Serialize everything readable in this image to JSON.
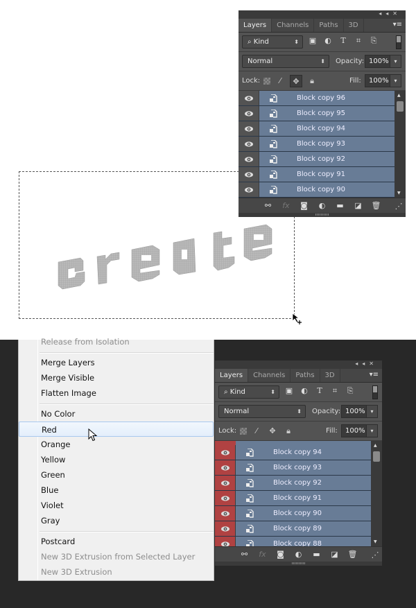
{
  "canvas": {
    "artwork_text": "create",
    "artwork_color": "#b8b8b8"
  },
  "panel_top": {
    "tabs": [
      "Layers",
      "Channels",
      "Paths",
      "3D"
    ],
    "active_tab": "Layers",
    "filter": {
      "label": "Kind"
    },
    "blend_mode": "Normal",
    "opacity_label": "Opacity:",
    "opacity_value": "100%",
    "lock_label": "Lock:",
    "fill_label": "Fill:",
    "fill_value": "100%",
    "layers": [
      {
        "name": "Block copy 96",
        "visible": true
      },
      {
        "name": "Block copy 95",
        "visible": true
      },
      {
        "name": "Block copy 94",
        "visible": true
      },
      {
        "name": "Block copy 93",
        "visible": true
      },
      {
        "name": "Block copy 92",
        "visible": true
      },
      {
        "name": "Block copy 91",
        "visible": true
      },
      {
        "name": "Block copy 90",
        "visible": true
      }
    ],
    "layer_color": "none"
  },
  "panel_bottom": {
    "tabs": [
      "Layers",
      "Channels",
      "Paths",
      "3D"
    ],
    "active_tab": "Layers",
    "filter": {
      "label": "Kind"
    },
    "blend_mode": "Normal",
    "opacity_label": "Opacity:",
    "opacity_value": "100%",
    "lock_label": "Lock:",
    "fill_label": "Fill:",
    "fill_value": "100%",
    "layers": [
      {
        "name": "Block copy 94",
        "visible": true
      },
      {
        "name": "Block copy 93",
        "visible": true
      },
      {
        "name": "Block copy 92",
        "visible": true
      },
      {
        "name": "Block copy 91",
        "visible": true
      },
      {
        "name": "Block copy 90",
        "visible": true
      },
      {
        "name": "Block copy 89",
        "visible": true
      },
      {
        "name": "Block copy 88",
        "visible": true
      }
    ],
    "layer_color": "#b04242"
  },
  "context_menu": {
    "items": [
      {
        "label": "Release from Isolation",
        "disabled": true
      },
      {
        "separator": true
      },
      {
        "label": "Merge Layers"
      },
      {
        "label": "Merge Visible"
      },
      {
        "label": "Flatten Image"
      },
      {
        "separator": true
      },
      {
        "label": "No Color"
      },
      {
        "label": "Red",
        "hover": true
      },
      {
        "label": "Orange"
      },
      {
        "label": "Yellow"
      },
      {
        "label": "Green"
      },
      {
        "label": "Blue"
      },
      {
        "label": "Violet"
      },
      {
        "label": "Gray"
      },
      {
        "separator": true
      },
      {
        "label": "Postcard"
      },
      {
        "label": "New 3D Extrusion from Selected Layer",
        "disabled": true
      },
      {
        "label": "New 3D Extrusion",
        "disabled": true
      }
    ]
  },
  "colors": {
    "panel_bg": "#535353",
    "layer_selected": "#687c96",
    "red_label": "#b04242",
    "menu_bg": "#f0f0f0"
  }
}
